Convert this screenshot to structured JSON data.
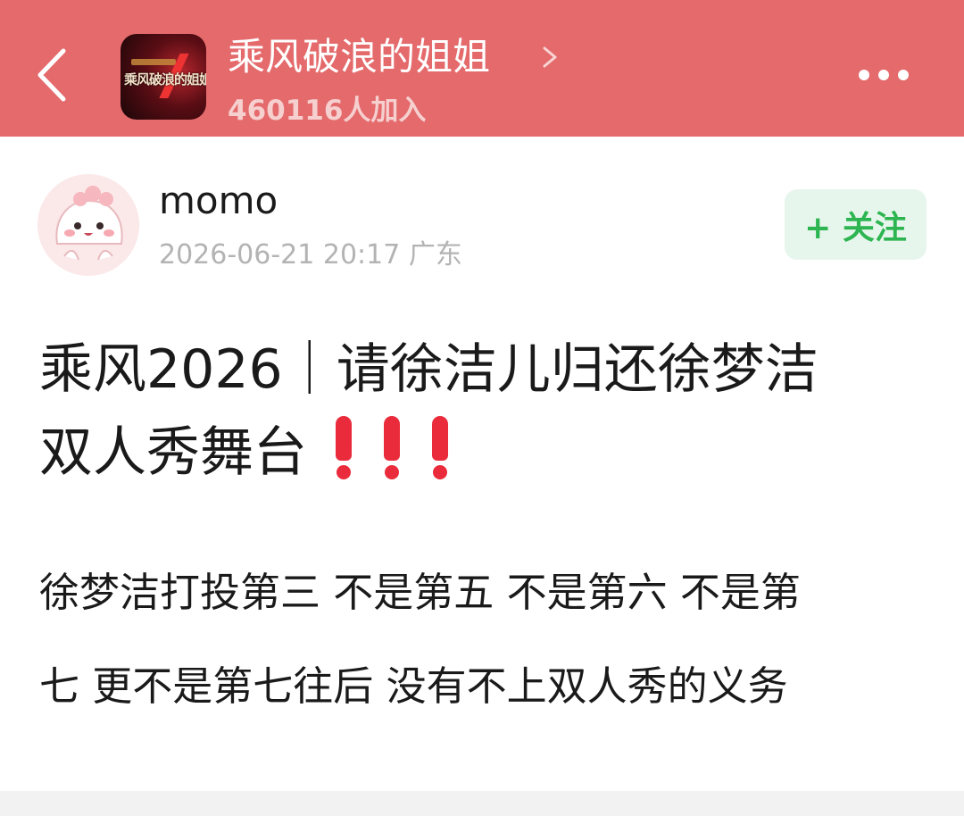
{
  "header": {
    "group_name": "乘风破浪的姐姐",
    "member_count": "460116人加入",
    "avatar_logo_text": "乘风破浪的姐姐",
    "bg_color": "#e46a6c"
  },
  "post": {
    "author": "momo",
    "meta": "2026-06-21 20:17  广东",
    "follow_label": "+ 关注",
    "title_line1": "乘风2026｜请徐洁儿归还徐梦洁",
    "title_line2": "双人秀舞台",
    "title_emoji": "❗❗❗",
    "body_line1": "徐梦洁打投第三 不是第五 不是第六 不是第",
    "body_line2": "七 更不是第七往后 没有不上双人秀的义务"
  },
  "icons": {
    "back": "back-arrow-icon",
    "more": "more-dots-icon",
    "chevron": "chevron-right-icon"
  },
  "colors": {
    "follow_text": "#2db551",
    "follow_bg": "#e7f6ec",
    "exclaim": "#ea2b3b"
  }
}
